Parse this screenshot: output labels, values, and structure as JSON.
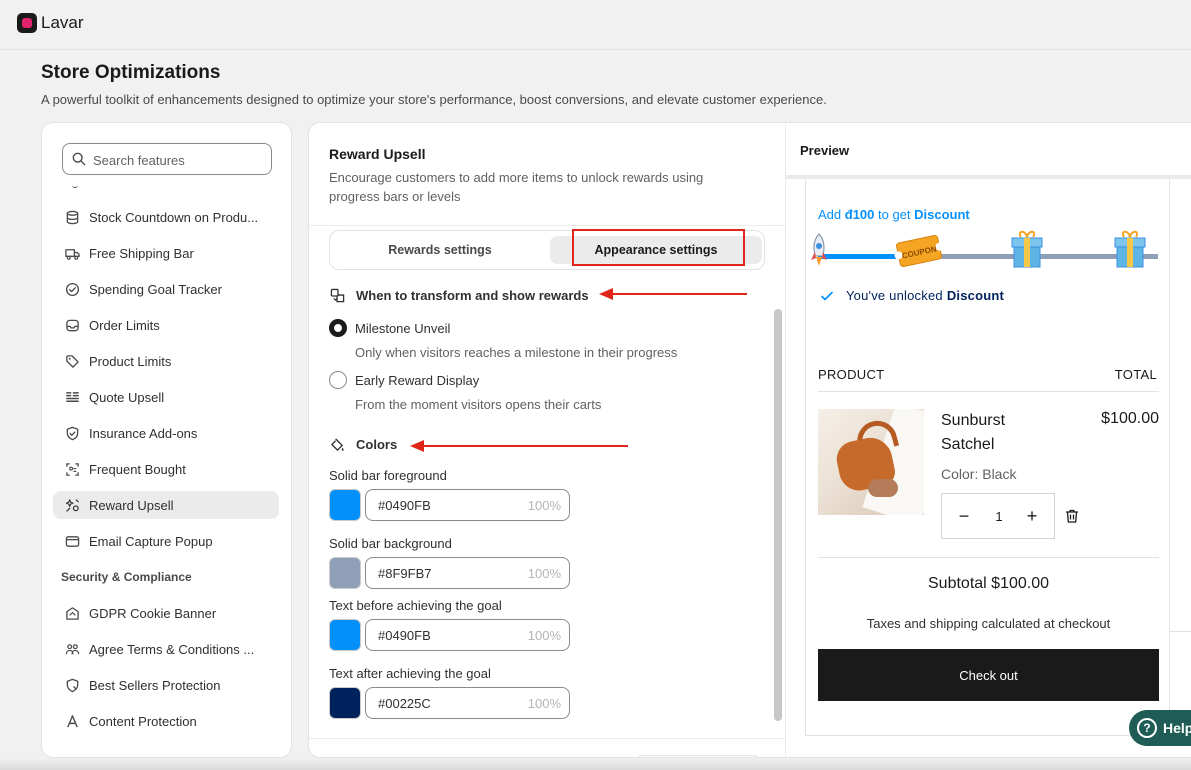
{
  "app": {
    "name": "Lavar"
  },
  "page": {
    "title": "Store Optimizations",
    "subtitle": "A powerful toolkit of enhancements designed to optimize your store's performance, boost conversions, and elevate customer experience."
  },
  "sidebar": {
    "search_placeholder": "Search features",
    "items": [
      {
        "label": "Stock Countdown on Produ...",
        "icon": "database-icon"
      },
      {
        "label": "Free Shipping Bar",
        "icon": "truck-icon"
      },
      {
        "label": "Spending Goal Tracker",
        "icon": "check-circle-icon"
      },
      {
        "label": "Order Limits",
        "icon": "inbox-icon"
      },
      {
        "label": "Product Limits",
        "icon": "tag-icon"
      },
      {
        "label": "Quote Upsell",
        "icon": "list-icon"
      },
      {
        "label": "Insurance Add-ons",
        "icon": "shield-check-icon"
      },
      {
        "label": "Frequent Bought",
        "icon": "scan-icon"
      },
      {
        "label": "Reward Upsell",
        "icon": "sparkle-icon",
        "active": true
      },
      {
        "label": "Email Capture Popup",
        "icon": "mail-icon"
      }
    ],
    "section2": "Security & Compliance",
    "items2": [
      {
        "label": "GDPR Cookie Banner",
        "icon": "cookie-icon"
      },
      {
        "label": "Agree Terms & Conditions ...",
        "icon": "people-icon"
      },
      {
        "label": "Best Sellers Protection",
        "icon": "shield-tag-icon"
      },
      {
        "label": "Content Protection",
        "icon": "text-a-icon"
      }
    ]
  },
  "settings": {
    "title": "Reward Upsell",
    "description": "Encourage customers to add more items to unlock rewards using progress bars or levels",
    "tabs": [
      {
        "label": "Rewards settings"
      },
      {
        "label": "Appearance settings",
        "selected": true
      }
    ],
    "transform_heading": "When to transform and show rewards",
    "options": [
      {
        "label": "Milestone Unveil",
        "help": "Only when visitors reaches a milestone in their progress",
        "checked": true
      },
      {
        "label": "Early Reward Display",
        "help": "From the moment visitors opens their carts",
        "checked": false
      }
    ],
    "colors_heading": "Colors",
    "colors": [
      {
        "label": "Solid bar foreground",
        "value": "#0490FB",
        "opacity": "100%"
      },
      {
        "label": "Solid bar background",
        "value": "#8F9FB7",
        "opacity": "100%"
      },
      {
        "label": "Text before achieving the goal",
        "value": "#0490FB",
        "opacity": "100%"
      },
      {
        "label": "Text after achieving the goal",
        "value": "#00225C",
        "opacity": "100%"
      }
    ]
  },
  "preview": {
    "title": "Preview",
    "goal_prefix": "Add ",
    "goal_amount": "đ100",
    "goal_middle": " to get ",
    "goal_reward": "Discount",
    "progress": 0.36,
    "milestones": [
      "rocket-icon",
      "coupon-icon",
      "gift-icon",
      "gift-icon"
    ],
    "coupon_text": "COUPON",
    "unlocked_prefix": "You've unlocked ",
    "unlocked_reward": "Discount",
    "col_product": "PRODUCT",
    "col_total": "TOTAL",
    "product": {
      "name": "Sunburst Satchel",
      "price": "$100.00",
      "variant": "Color: Black",
      "qty": "1",
      "minus": "−",
      "plus": "+"
    },
    "subtotal": "Subtotal $100.00",
    "tax_note": "Taxes and shipping calculated at checkout",
    "checkout": "Check out"
  },
  "help": {
    "label": "Help",
    "icon": "question-icon"
  },
  "colors_ui": {
    "accent": "#0490FB",
    "bar_bg": "#8F9FB7",
    "after": "#00225C",
    "annotation": "#e0251b"
  }
}
